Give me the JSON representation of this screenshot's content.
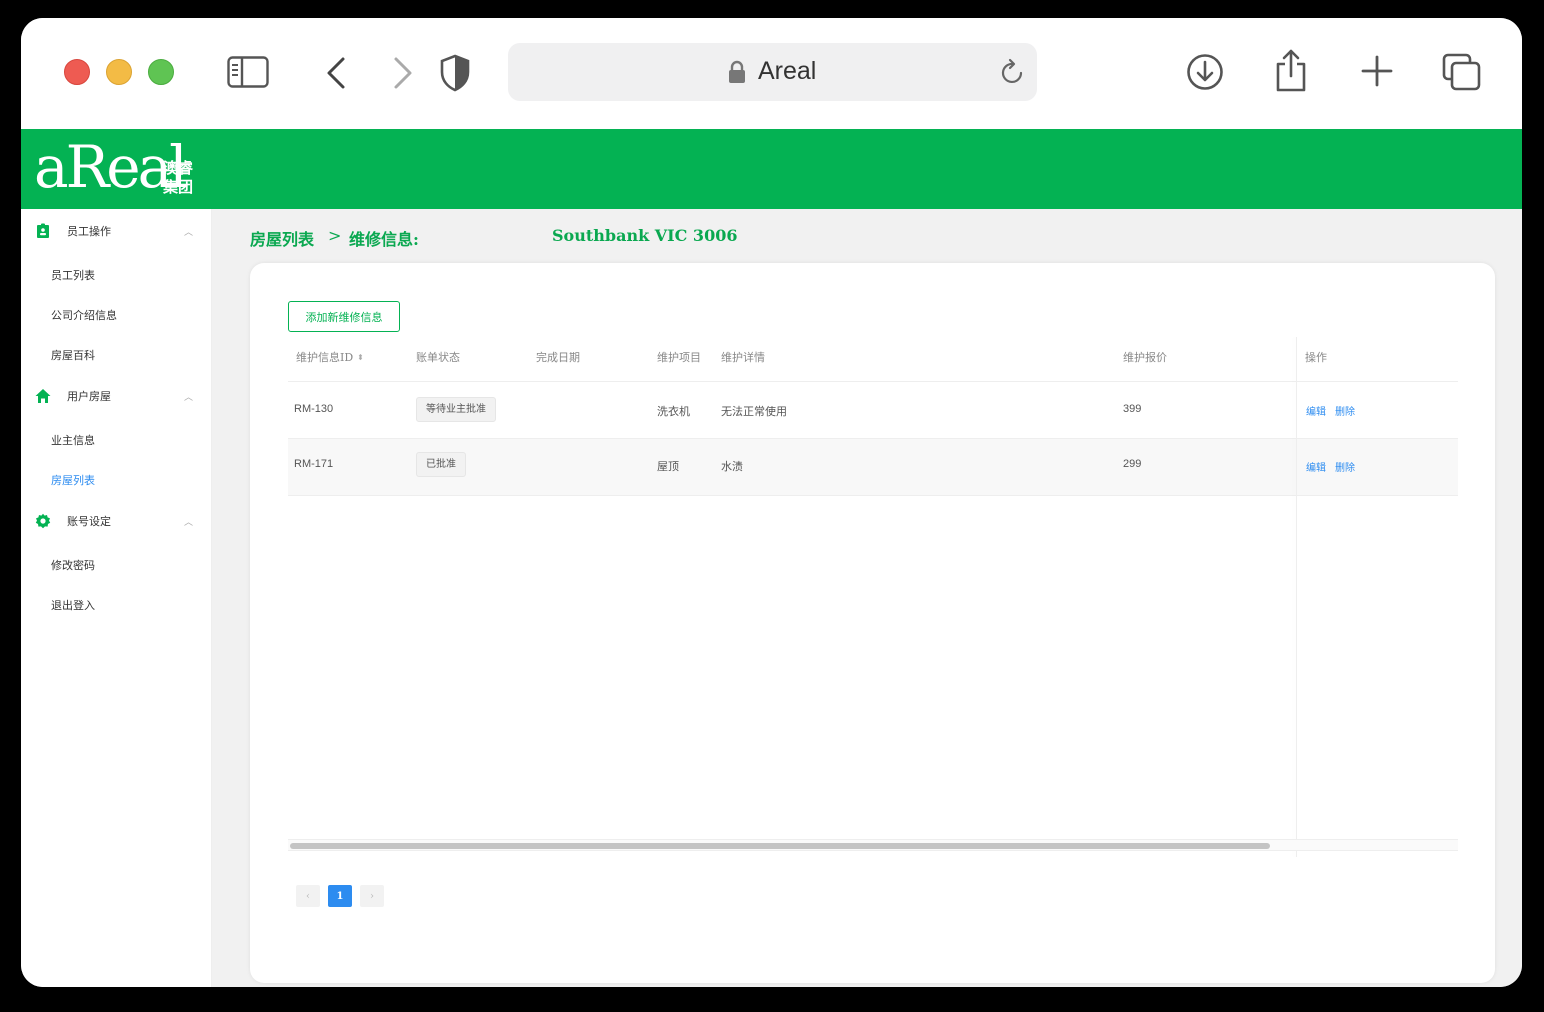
{
  "browser": {
    "url_title": "Areal",
    "icons": [
      "sidebar-icon",
      "back-icon",
      "forward-icon",
      "shield-icon",
      "lock-icon",
      "reload-icon",
      "download-icon",
      "share-icon",
      "new-tab-icon",
      "tabs-overview-icon"
    ]
  },
  "brand": {
    "logo_text": "aReal",
    "logo_cn_line1": "澳睿",
    "logo_cn_line2": "集团",
    "color": "#04b253"
  },
  "sidebar": {
    "groups": [
      {
        "label": "员工操作",
        "icon": "badge-icon",
        "items": [
          "员工列表",
          "公司介绍信息",
          "房屋百科"
        ]
      },
      {
        "label": "用户房屋",
        "icon": "home-icon",
        "items": [
          "业主信息",
          "房屋列表"
        ]
      },
      {
        "label": "账号设定",
        "icon": "gear-icon",
        "items": [
          "修改密码",
          "退出登入"
        ]
      }
    ],
    "active_item": "房屋列表"
  },
  "breadcrumb": {
    "level1": "房屋列表",
    "separator": ">",
    "level2": "维修信息:",
    "address": "Southbank VIC 3006"
  },
  "toolbar": {
    "add_button": "添加新维修信息"
  },
  "table": {
    "headers": {
      "id": "维护信息ID",
      "status": "账单状态",
      "done_date": "完成日期",
      "item": "维护项目",
      "detail": "维护详情",
      "price": "维护报价",
      "actions": "操作"
    },
    "rows": [
      {
        "id": "RM-130",
        "status": "等待业主批准",
        "done_date": "",
        "item": "洗衣机",
        "detail": "无法正常使用",
        "price": "399",
        "edit": "编辑",
        "delete": "删除"
      },
      {
        "id": "RM-171",
        "status": "已批准",
        "done_date": "",
        "item": "屋顶",
        "detail": "水渍",
        "price": "299",
        "edit": "编辑",
        "delete": "删除"
      }
    ]
  },
  "pagination": {
    "prev": "‹",
    "current": "1",
    "next": "›"
  }
}
